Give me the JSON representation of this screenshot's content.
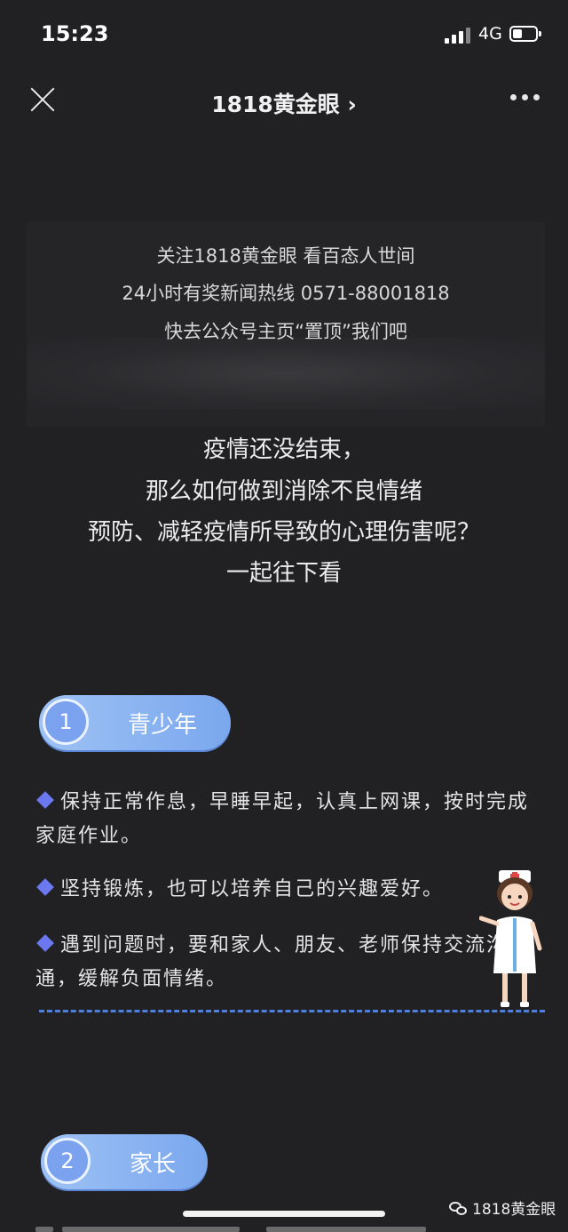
{
  "status_bar": {
    "time": "15:23",
    "network": "4G"
  },
  "nav": {
    "title": "1818黄金眼 ›"
  },
  "follow_box": {
    "lines": [
      "关注1818黄金眼 看百态人世间",
      "24小时有奖新闻热线 0571-88001818",
      "快去公众号主页“置顶”我们吧"
    ]
  },
  "intro": {
    "lines": [
      "疫情还没结束，",
      "那么如何做到消除不良情绪",
      "预防、减轻疫情所导致的心理伤害呢？",
      "一起往下看"
    ]
  },
  "sections": [
    {
      "number": "1",
      "title": "青少年",
      "items": [
        "保持正常作息，早睡早起，认真上网课，按时完成家庭作业。",
        "坚持锻炼，也可以培养自己的兴趣爱好。",
        "遇到问题时，要和家人、朋友、老师保持交流沟通，缓解负面情绪。"
      ]
    },
    {
      "number": "2",
      "title": "家长"
    }
  ],
  "watermark": "1818黄金眼",
  "colors": {
    "background": "#212124",
    "pill": "#7aa7ee",
    "bullet": "#6b78f0",
    "dash": "#4d7fe0"
  }
}
